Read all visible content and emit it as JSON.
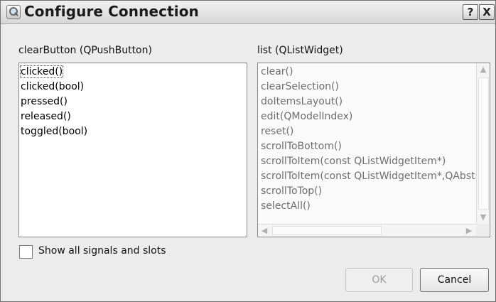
{
  "dialog": {
    "title": "Configure Connection",
    "help_glyph": "?",
    "close_glyph": "X"
  },
  "sender": {
    "label": "clearButton (QPushButton)",
    "items": [
      "clicked()",
      "clicked(bool)",
      "pressed()",
      "released()",
      "toggled(bool)"
    ],
    "focused_index": 0
  },
  "receiver": {
    "label": "list (QListWidget)",
    "items": [
      "clear()",
      "clearSelection()",
      "doItemsLayout()",
      "edit(QModelIndex)",
      "reset()",
      "scrollToBottom()",
      "scrollToItem(const QListWidgetItem*)",
      "scrollToItem(const QListWidgetItem*,QAbstractItemView::ScrollHint)",
      "scrollToTop()",
      "selectAll()"
    ],
    "enabled": false
  },
  "show_all": {
    "label": "Show all signals and slots",
    "checked": false
  },
  "buttons": {
    "ok": "OK",
    "cancel": "Cancel"
  },
  "icons": {
    "app": "signal-slot-editor-icon",
    "scroll_up": "▲",
    "scroll_down": "▼",
    "scroll_left": "◀",
    "scroll_right": "▶"
  },
  "colors": {
    "enabled_text": "#000000",
    "disabled_text": "#6e6e6e"
  }
}
